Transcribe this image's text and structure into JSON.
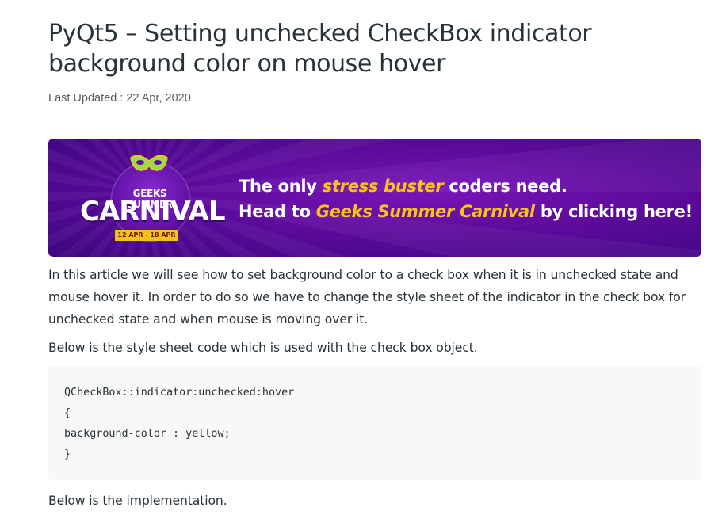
{
  "article": {
    "title": "PyQt5 – Setting unchecked CheckBox indicator background color on mouse hover",
    "last_updated": "Last Updated : 22 Apr, 2020"
  },
  "banner": {
    "logo_top": "GEEKS SUMMER",
    "logo_main": "CARNIVAL",
    "logo_dates": "12 APR - 18 APR",
    "line1_a": "The only ",
    "line1_hl": "stress buster",
    "line1_b": " coders need.",
    "line2_a": "Head to ",
    "line2_hl": "Geeks Summer Carnival",
    "line2_b": " by clicking here!",
    "colors": {
      "background": "#5c0b9c",
      "highlight": "#f9c21a"
    }
  },
  "body": {
    "paragraph1": "In this article we will see how to set background color to a check box when it is in unchecked state and mouse hover it. In order to do so we have to change the style sheet of the indicator in the check box for unchecked state and when mouse is moving over it.",
    "paragraph2": "Below is the style sheet code which is used with the check box object.",
    "code": "QCheckBox::indicator:unchecked:hover\n{\nbackground-color : yellow;\n}",
    "paragraph3": "Below is the implementation."
  }
}
